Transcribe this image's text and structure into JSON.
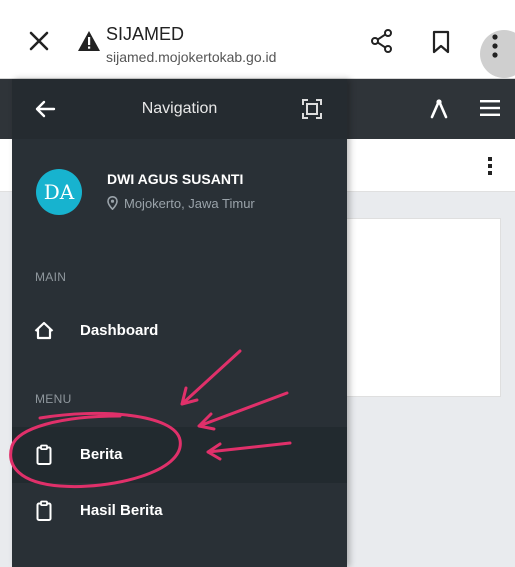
{
  "browser": {
    "title": "SIJAMED",
    "url": "sijamed.mojokertokab.go.id"
  },
  "drawer": {
    "title": "Navigation",
    "user": {
      "initials": "DA",
      "name": "DWI AGUS SUSANTI",
      "location": "Mojokerto, Jawa Timur"
    },
    "sections": {
      "main": "MAIN",
      "menu": "MENU"
    },
    "items": [
      {
        "label": "Dashboard",
        "icon": "home-icon",
        "active": false
      },
      {
        "label": "Berita",
        "icon": "clipboard-icon",
        "active": true
      },
      {
        "label": "Hasil Berita",
        "icon": "clipboard-icon",
        "active": false
      }
    ]
  },
  "colors": {
    "drawer_bg": "#293036",
    "avatar_bg": "#17b3cf",
    "annotation": "#e0306a"
  },
  "icons": [
    "close-icon",
    "warning-icon",
    "share-icon",
    "bookmark-icon",
    "more-vert-icon",
    "back-arrow-icon",
    "fullscreen-icon",
    "fork-icon",
    "hamburger-icon",
    "location-pin-icon"
  ]
}
